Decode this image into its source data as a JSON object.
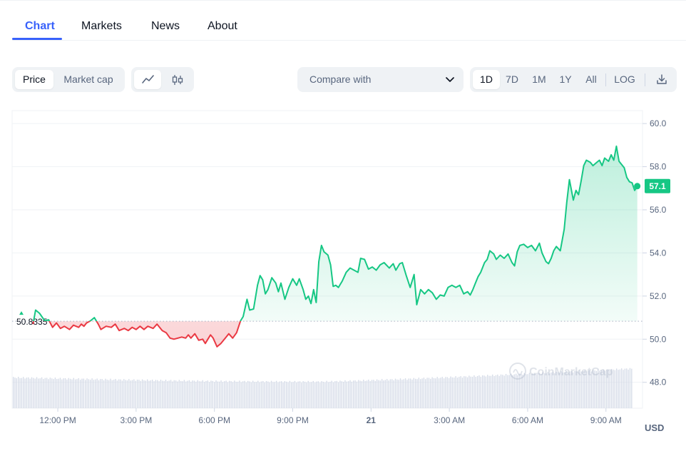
{
  "tabs": [
    {
      "label": "Chart",
      "active": true
    },
    {
      "label": "Markets",
      "active": false
    },
    {
      "label": "News",
      "active": false
    },
    {
      "label": "About",
      "active": false
    }
  ],
  "toolbar": {
    "metric_options": [
      "Price",
      "Market cap"
    ],
    "metric_selected": "Price",
    "chart_style_icons": [
      "line-chart-icon",
      "candlestick-icon"
    ],
    "chart_style_selected": "line-chart-icon",
    "compare_label": "Compare with",
    "ranges": [
      "1D",
      "7D",
      "1M",
      "1Y",
      "All"
    ],
    "range_selected": "1D",
    "log_label": "LOG",
    "download_icon": "download-icon"
  },
  "chart_data": {
    "type": "line",
    "currency_label": "USD",
    "y_ticks": [
      "60.0",
      "58.0",
      "56.0",
      "54.0",
      "52.0",
      "50.0",
      "48.0"
    ],
    "ylim": [
      46.8,
      60.6
    ],
    "x_ticks": [
      {
        "label": "12:00 PM",
        "t": 12,
        "bold": false
      },
      {
        "label": "3:00 PM",
        "t": 15,
        "bold": false
      },
      {
        "label": "6:00 PM",
        "t": 18,
        "bold": false
      },
      {
        "label": "9:00 PM",
        "t": 21,
        "bold": false
      },
      {
        "label": "21",
        "t": 24,
        "bold": true
      },
      {
        "label": "3:00 AM",
        "t": 27,
        "bold": false
      },
      {
        "label": "6:00 AM",
        "t": 30,
        "bold": false
      },
      {
        "label": "9:00 AM",
        "t": 33,
        "bold": false
      }
    ],
    "xlim": [
      10.25,
      34.4
    ],
    "reference_price": 50.8335,
    "reference_label": "50.8335",
    "current_price": 57.1,
    "current_label": "57.1",
    "up_color": "#16c784",
    "down_color": "#ea3943",
    "series": [
      [
        11.05,
        50.7
      ],
      [
        11.15,
        51.35
      ],
      [
        11.3,
        51.2
      ],
      [
        11.5,
        50.85
      ],
      [
        11.65,
        50.9
      ],
      [
        11.8,
        50.55
      ],
      [
        11.95,
        50.75
      ],
      [
        12.1,
        50.5
      ],
      [
        12.25,
        50.6
      ],
      [
        12.45,
        50.45
      ],
      [
        12.6,
        50.65
      ],
      [
        12.8,
        50.55
      ],
      [
        12.9,
        50.7
      ],
      [
        13.0,
        50.6
      ],
      [
        13.1,
        50.75
      ],
      [
        13.25,
        50.85
      ],
      [
        13.4,
        51.0
      ],
      [
        13.55,
        50.7
      ],
      [
        13.65,
        50.45
      ],
      [
        13.85,
        50.6
      ],
      [
        14.05,
        50.55
      ],
      [
        14.2,
        50.7
      ],
      [
        14.35,
        50.4
      ],
      [
        14.55,
        50.5
      ],
      [
        14.7,
        50.4
      ],
      [
        14.85,
        50.55
      ],
      [
        15.0,
        50.45
      ],
      [
        15.15,
        50.6
      ],
      [
        15.3,
        50.45
      ],
      [
        15.45,
        50.6
      ],
      [
        15.65,
        50.5
      ],
      [
        15.8,
        50.7
      ],
      [
        16.0,
        50.4
      ],
      [
        16.15,
        50.3
      ],
      [
        16.3,
        50.05
      ],
      [
        16.45,
        50.0
      ],
      [
        16.6,
        50.05
      ],
      [
        16.75,
        50.1
      ],
      [
        16.9,
        50.05
      ],
      [
        17.0,
        50.2
      ],
      [
        17.1,
        50.05
      ],
      [
        17.25,
        50.25
      ],
      [
        17.4,
        49.95
      ],
      [
        17.55,
        50.0
      ],
      [
        17.65,
        49.8
      ],
      [
        17.75,
        50.0
      ],
      [
        17.85,
        50.2
      ],
      [
        17.95,
        50.05
      ],
      [
        18.1,
        49.65
      ],
      [
        18.25,
        49.8
      ],
      [
        18.35,
        49.95
      ],
      [
        18.45,
        50.1
      ],
      [
        18.55,
        50.25
      ],
      [
        18.7,
        50.05
      ],
      [
        18.85,
        50.3
      ],
      [
        19.0,
        50.85
      ],
      [
        19.1,
        51.05
      ],
      [
        19.25,
        51.85
      ],
      [
        19.35,
        51.35
      ],
      [
        19.5,
        51.4
      ],
      [
        19.65,
        52.5
      ],
      [
        19.75,
        52.95
      ],
      [
        19.85,
        52.75
      ],
      [
        19.95,
        52.1
      ],
      [
        20.05,
        52.3
      ],
      [
        20.2,
        52.85
      ],
      [
        20.35,
        52.6
      ],
      [
        20.45,
        52.2
      ],
      [
        20.55,
        52.6
      ],
      [
        20.7,
        51.85
      ],
      [
        20.85,
        52.4
      ],
      [
        21.0,
        52.8
      ],
      [
        21.15,
        52.5
      ],
      [
        21.25,
        52.8
      ],
      [
        21.4,
        52.3
      ],
      [
        21.5,
        51.85
      ],
      [
        21.6,
        52.0
      ],
      [
        21.7,
        51.65
      ],
      [
        21.8,
        52.3
      ],
      [
        21.9,
        51.7
      ],
      [
        22.0,
        53.6
      ],
      [
        22.1,
        54.35
      ],
      [
        22.2,
        54.05
      ],
      [
        22.35,
        53.9
      ],
      [
        22.45,
        53.45
      ],
      [
        22.55,
        52.45
      ],
      [
        22.65,
        52.5
      ],
      [
        22.75,
        52.4
      ],
      [
        22.9,
        52.7
      ],
      [
        23.05,
        53.1
      ],
      [
        23.2,
        53.3
      ],
      [
        23.35,
        53.2
      ],
      [
        23.5,
        53.1
      ],
      [
        23.6,
        53.75
      ],
      [
        23.75,
        53.7
      ],
      [
        23.9,
        53.25
      ],
      [
        24.05,
        53.35
      ],
      [
        24.2,
        53.2
      ],
      [
        24.35,
        53.45
      ],
      [
        24.5,
        53.55
      ],
      [
        24.7,
        53.3
      ],
      [
        24.85,
        53.5
      ],
      [
        24.95,
        53.2
      ],
      [
        25.1,
        53.5
      ],
      [
        25.2,
        53.55
      ],
      [
        25.35,
        52.95
      ],
      [
        25.5,
        52.4
      ],
      [
        25.65,
        53.0
      ],
      [
        25.75,
        51.6
      ],
      [
        25.9,
        52.3
      ],
      [
        26.05,
        52.1
      ],
      [
        26.2,
        52.3
      ],
      [
        26.35,
        52.15
      ],
      [
        26.5,
        51.85
      ],
      [
        26.65,
        52.05
      ],
      [
        26.8,
        52.0
      ],
      [
        26.95,
        52.4
      ],
      [
        27.1,
        52.5
      ],
      [
        27.25,
        52.4
      ],
      [
        27.4,
        52.5
      ],
      [
        27.55,
        52.1
      ],
      [
        27.7,
        52.2
      ],
      [
        27.8,
        52.05
      ],
      [
        27.9,
        52.3
      ],
      [
        28.0,
        52.6
      ],
      [
        28.1,
        52.9
      ],
      [
        28.2,
        53.1
      ],
      [
        28.35,
        53.55
      ],
      [
        28.45,
        53.7
      ],
      [
        28.55,
        54.1
      ],
      [
        28.7,
        53.95
      ],
      [
        28.8,
        53.7
      ],
      [
        28.95,
        53.9
      ],
      [
        29.1,
        53.75
      ],
      [
        29.25,
        53.95
      ],
      [
        29.4,
        53.55
      ],
      [
        29.5,
        53.4
      ],
      [
        29.6,
        54.05
      ],
      [
        29.7,
        54.35
      ],
      [
        29.85,
        54.4
      ],
      [
        30.0,
        54.25
      ],
      [
        30.15,
        54.35
      ],
      [
        30.3,
        54.1
      ],
      [
        30.45,
        54.45
      ],
      [
        30.55,
        54.0
      ],
      [
        30.7,
        53.6
      ],
      [
        30.8,
        53.5
      ],
      [
        30.9,
        53.75
      ],
      [
        31.0,
        54.1
      ],
      [
        31.1,
        54.3
      ],
      [
        31.25,
        54.1
      ],
      [
        31.4,
        55.1
      ],
      [
        31.5,
        56.35
      ],
      [
        31.6,
        57.4
      ],
      [
        31.75,
        56.45
      ],
      [
        31.85,
        56.9
      ],
      [
        31.95,
        56.7
      ],
      [
        32.05,
        57.35
      ],
      [
        32.15,
        58.05
      ],
      [
        32.25,
        58.3
      ],
      [
        32.4,
        58.2
      ],
      [
        32.5,
        58.05
      ],
      [
        32.65,
        58.2
      ],
      [
        32.75,
        58.3
      ],
      [
        32.85,
        58.05
      ],
      [
        32.95,
        58.4
      ],
      [
        33.1,
        58.25
      ],
      [
        33.2,
        58.55
      ],
      [
        33.3,
        58.3
      ],
      [
        33.4,
        58.95
      ],
      [
        33.5,
        58.25
      ],
      [
        33.6,
        58.1
      ],
      [
        33.7,
        57.95
      ],
      [
        33.8,
        57.5
      ],
      [
        33.9,
        57.3
      ],
      [
        34.0,
        57.25
      ],
      [
        34.1,
        56.9
      ],
      [
        34.2,
        57.1
      ]
    ]
  }
}
